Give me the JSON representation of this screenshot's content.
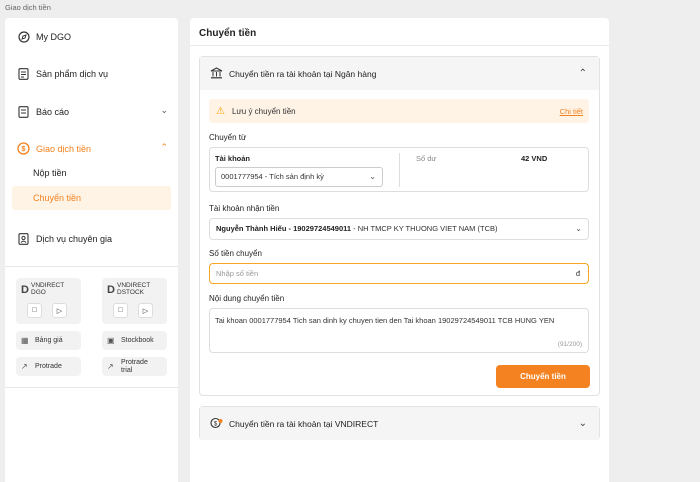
{
  "page": {
    "breadcrumb": "Giao dịch tiền"
  },
  "sidebar": {
    "items": [
      {
        "label": "My DGO",
        "icon": "compass-icon"
      },
      {
        "label": "Sản phẩm dịch vụ",
        "icon": "document-icon"
      },
      {
        "label": "Báo cáo",
        "icon": "report-icon"
      },
      {
        "label": "Giao dịch tiền",
        "icon": "money-exchange-icon"
      },
      {
        "label": "Dịch vụ chuyên gia",
        "icon": "expert-icon"
      }
    ],
    "subitems": [
      {
        "label": "Nộp tiền"
      },
      {
        "label": "Chuyển tiền"
      }
    ],
    "apps": [
      {
        "name": "VNDIRECT DGO"
      },
      {
        "name": "VNDIRECT DSTOCK"
      }
    ],
    "tools": [
      "Bảng giá",
      "Stockbook",
      "Protrade",
      "Protrade trial"
    ]
  },
  "main": {
    "title": "Chuyển tiền",
    "bank_section": {
      "header": "Chuyển tiền ra tài khoản tại Ngân hàng",
      "notice": "Lưu ý chuyển tiền",
      "notice_link": "Chi tiết",
      "from_label": "Chuyển từ",
      "account_label": "Tài khoản",
      "account_value": "0001777954 - Tích sản định kỳ",
      "balance_label": "Số dư",
      "balance_value": "42 VND",
      "receiver_label": "Tài khoản nhận tiền",
      "receiver_name": "Nguyễn Thành Hiếu - 19029724549011",
      "receiver_bank": "- NH TMCP KY THUONG VIET NAM (TCB)",
      "amount_label": "Số tiền chuyển",
      "amount_placeholder": "Nhập số tiền",
      "currency": "đ",
      "content_label": "Nội dung chuyển tiền",
      "content_value": "Tai khoan 0001777954 Tich san dinh ky chuyen tien den Tai khoan 19029724549011 TCB HUNG YEN",
      "char_count": "(91/200)",
      "submit": "Chuyển tiền"
    },
    "vnd_section": {
      "header": "Chuyển tiền ra tài khoản tại VNDIRECT"
    }
  },
  "colors": {
    "accent": "#f58220",
    "notice_bg": "#fff3e6"
  }
}
